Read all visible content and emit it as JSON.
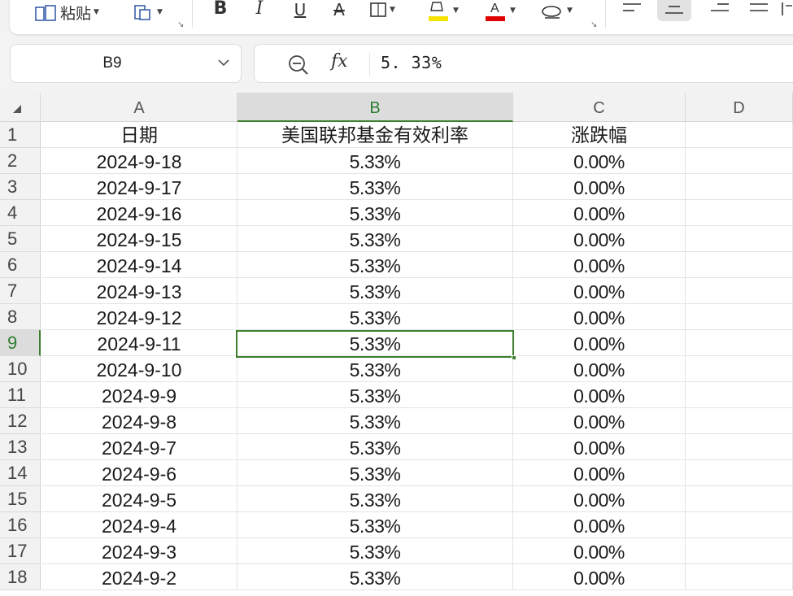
{
  "ribbon": {
    "paste_label": "粘贴",
    "colors": {
      "highlight": "#f5e400",
      "font_color": "#e00000"
    }
  },
  "name_box": {
    "ref": "B9"
  },
  "formula_bar": {
    "fx_label": "fx",
    "value": "5. 33%"
  },
  "columns": [
    "A",
    "B",
    "C",
    "D"
  ],
  "rows": [
    {
      "num": "1",
      "a": "日期",
      "b": "美国联邦基金有效利率",
      "c": "涨跌幅"
    },
    {
      "num": "2",
      "a": "2024-9-18",
      "b": "5.33%",
      "c": "0.00%"
    },
    {
      "num": "3",
      "a": "2024-9-17",
      "b": "5.33%",
      "c": "0.00%"
    },
    {
      "num": "4",
      "a": "2024-9-16",
      "b": "5.33%",
      "c": "0.00%"
    },
    {
      "num": "5",
      "a": "2024-9-15",
      "b": "5.33%",
      "c": "0.00%"
    },
    {
      "num": "6",
      "a": "2024-9-14",
      "b": "5.33%",
      "c": "0.00%"
    },
    {
      "num": "7",
      "a": "2024-9-13",
      "b": "5.33%",
      "c": "0.00%"
    },
    {
      "num": "8",
      "a": "2024-9-12",
      "b": "5.33%",
      "c": "0.00%"
    },
    {
      "num": "9",
      "a": "2024-9-11",
      "b": "5.33%",
      "c": "0.00%"
    },
    {
      "num": "10",
      "a": "2024-9-10",
      "b": "5.33%",
      "c": "0.00%"
    },
    {
      "num": "11",
      "a": "2024-9-9",
      "b": "5.33%",
      "c": "0.00%"
    },
    {
      "num": "12",
      "a": "2024-9-8",
      "b": "5.33%",
      "c": "0.00%"
    },
    {
      "num": "13",
      "a": "2024-9-7",
      "b": "5.33%",
      "c": "0.00%"
    },
    {
      "num": "14",
      "a": "2024-9-6",
      "b": "5.33%",
      "c": "0.00%"
    },
    {
      "num": "15",
      "a": "2024-9-5",
      "b": "5.33%",
      "c": "0.00%"
    },
    {
      "num": "16",
      "a": "2024-9-4",
      "b": "5.33%",
      "c": "0.00%"
    },
    {
      "num": "17",
      "a": "2024-9-3",
      "b": "5.33%",
      "c": "0.00%"
    },
    {
      "num": "18",
      "a": "2024-9-2",
      "b": "5.33%",
      "c": "0.00%"
    }
  ],
  "selection": {
    "active_cell": "B9",
    "column": "B",
    "row": "9"
  }
}
